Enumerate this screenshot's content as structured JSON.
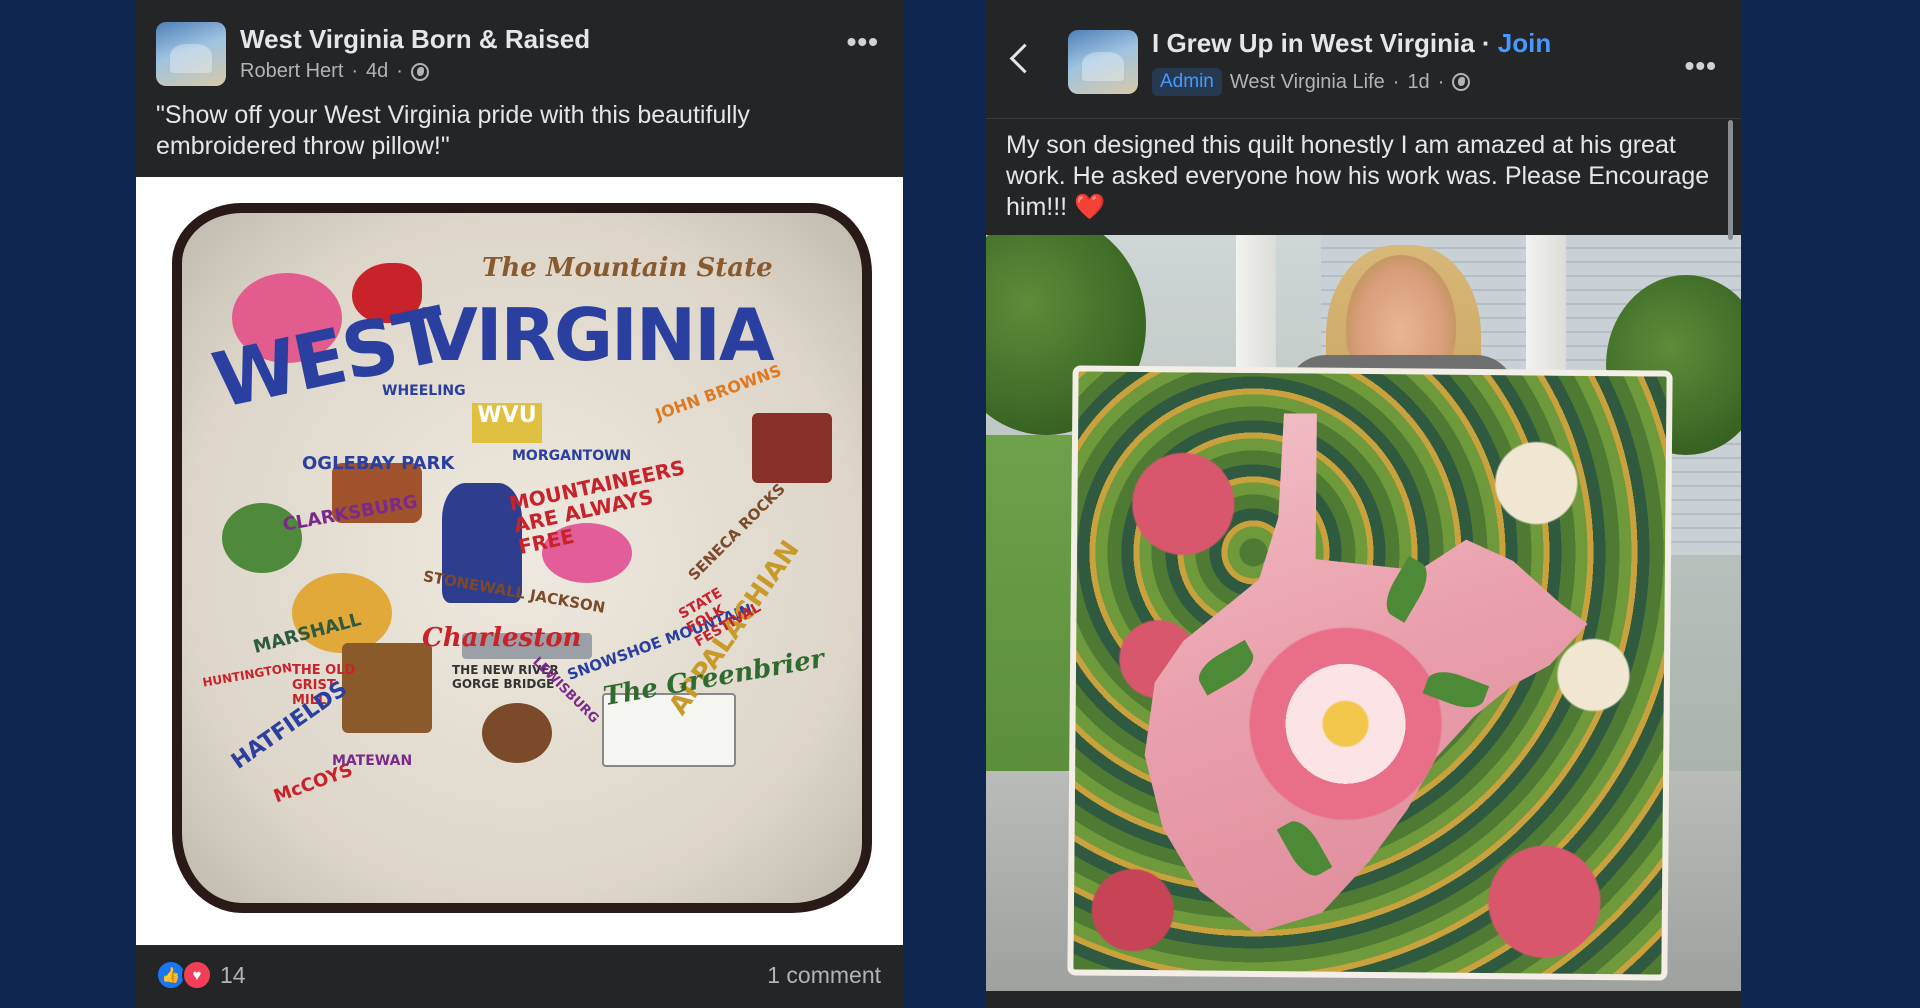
{
  "left_post": {
    "group_name": "West Virginia Born & Raised",
    "author": "Robert Hert",
    "time": "4d",
    "text": "\"Show off your West Virginia pride with this beautifully embroidered throw pillow!\"",
    "reaction_count": "14",
    "comments": "1 comment",
    "image_text": {
      "west": "WEST",
      "virginia": "VIRGINIA",
      "mountain_state": "The Mountain State",
      "wheeling": "WHEELING",
      "morgantown": "MORGANTOWN",
      "john_browns": "JOHN BROWNS",
      "oglebay": "OGLEBAY PARK",
      "mountaineers": "MOUNTAINEERS ARE ALWAYS FREE",
      "clarksburg": "CLARKSBURG",
      "seneca": "SENECA ROCKS",
      "stonewall": "STONEWALL JACKSON",
      "snowshoe": "SNOWSHOE MOUNTAIN",
      "marshall": "MARSHALL",
      "charleston": "Charleston",
      "appalachian": "APPALACHIAN",
      "state_folk": "STATE FOLK FESTIVAL",
      "grist_mill": "THE OLD GRIST MILL",
      "new_river": "THE NEW RIVER GORGE BRIDGE",
      "greenbrier": "The Greenbrier",
      "hatfields": "HATFIELDS",
      "mccoys": "McCOYS",
      "matewan": "MATEWAN",
      "lewisburg": "LEWISBURG",
      "huntington": "HUNTINGTON",
      "wvu": "WVU"
    }
  },
  "right_post": {
    "group_name": "I Grew Up in West Virginia",
    "join": "Join",
    "admin": "Admin",
    "author": "West Virginia Life",
    "time": "1d",
    "text": "My son designed this quilt honestly I am amazed at his great work. He asked everyone how his work was. Please Encourage him!!! ❤️"
  },
  "icons": {
    "more": "more-options-icon",
    "back": "back-arrow-icon",
    "globe": "globe-icon",
    "like": "like-reaction-icon",
    "love": "love-reaction-icon"
  },
  "colors": {
    "background": "#0f2750",
    "panel": "#242526",
    "text": "#e4e6eb",
    "secondary_text": "#b0b3b8",
    "link": "#4599ff",
    "like": "#1877f2",
    "love": "#f33e58"
  }
}
